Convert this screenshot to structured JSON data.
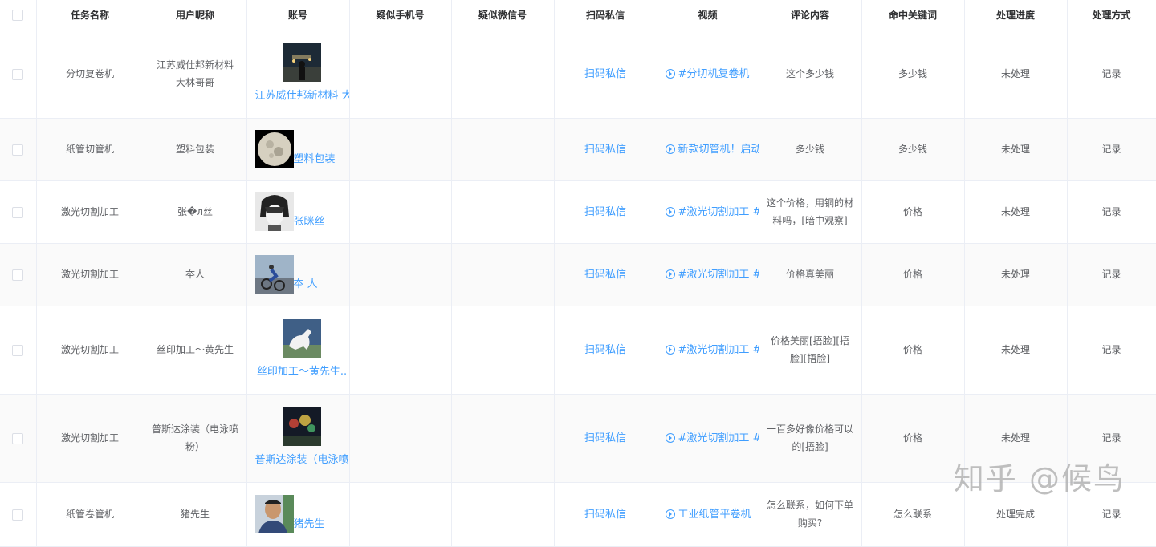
{
  "columns": [
    "任务名称",
    "用户昵称",
    "账号",
    "疑似手机号",
    "疑似微信号",
    "扫码私信",
    "视频",
    "评论内容",
    "命中关键词",
    "处理进度",
    "处理方式"
  ],
  "rows": [
    {
      "task": "分切复卷机",
      "nickname": "江苏威仕邦新材料 大林哥哥",
      "account": "江苏威仕邦新材料 大",
      "avatar": "night-person",
      "phone": "",
      "wechat": "",
      "scan": "扫码私信",
      "video": "#分切机复卷机",
      "comment": "这个多少钱",
      "keyword": "多少钱",
      "progress": "未处理",
      "action": "记录"
    },
    {
      "task": "纸管切管机",
      "nickname": "塑料包装",
      "account": "塑料包装",
      "avatar": "moon",
      "phone": "",
      "wechat": "",
      "scan": "扫码私信",
      "video": "新款切管机！启动",
      "comment": "多少钱",
      "keyword": "多少钱",
      "progress": "未处理",
      "action": "记录"
    },
    {
      "task": "激光切割加工",
      "nickname": "张�л丝",
      "account": "张眯丝",
      "avatar": "anime",
      "phone": "",
      "wechat": "",
      "scan": "扫码私信",
      "video": "#激光切割加工 #",
      "comment": "这个价格，用铜的材料吗，[暗中观察]",
      "keyword": "价格",
      "progress": "未处理",
      "action": "记录"
    },
    {
      "task": "激光切割加工",
      "nickname": "夲人",
      "account": "夲 人",
      "avatar": "cyclist",
      "phone": "",
      "wechat": "",
      "scan": "扫码私信",
      "video": "#激光切割加工 #",
      "comment": "价格真美丽",
      "keyword": "价格",
      "progress": "未处理",
      "action": "记录"
    },
    {
      "task": "激光切割加工",
      "nickname": "丝印加工～黄先生",
      "account": "丝印加工～黄先生..",
      "avatar": "horse",
      "phone": "",
      "wechat": "",
      "scan": "扫码私信",
      "video": "#激光切割加工 #",
      "comment": "价格美丽[捂脸][捂脸][捂脸]",
      "keyword": "价格",
      "progress": "未处理",
      "action": "记录"
    },
    {
      "task": "激光切割加工",
      "nickname": "普斯达涂装（电泳喷粉）",
      "account": "普斯达涂装（电泳喷",
      "avatar": "lights",
      "phone": "",
      "wechat": "",
      "scan": "扫码私信",
      "video": "#激光切割加工 #",
      "comment": "一百多好像价格可以的[捂脸]",
      "keyword": "价格",
      "progress": "未处理",
      "action": "记录"
    },
    {
      "task": "纸管卷管机",
      "nickname": "猪先生",
      "account": "猪先生",
      "avatar": "man",
      "phone": "",
      "wechat": "",
      "scan": "扫码私信",
      "video": "工业纸管平卷机",
      "comment": "怎么联系，如何下单购买?",
      "keyword": "怎么联系",
      "progress": "处理完成",
      "action": "记录"
    }
  ],
  "watermark": "知乎 @候鸟",
  "colors": {
    "link": "#409eff",
    "border": "#ebeef5",
    "stripe": "#fafafa"
  }
}
